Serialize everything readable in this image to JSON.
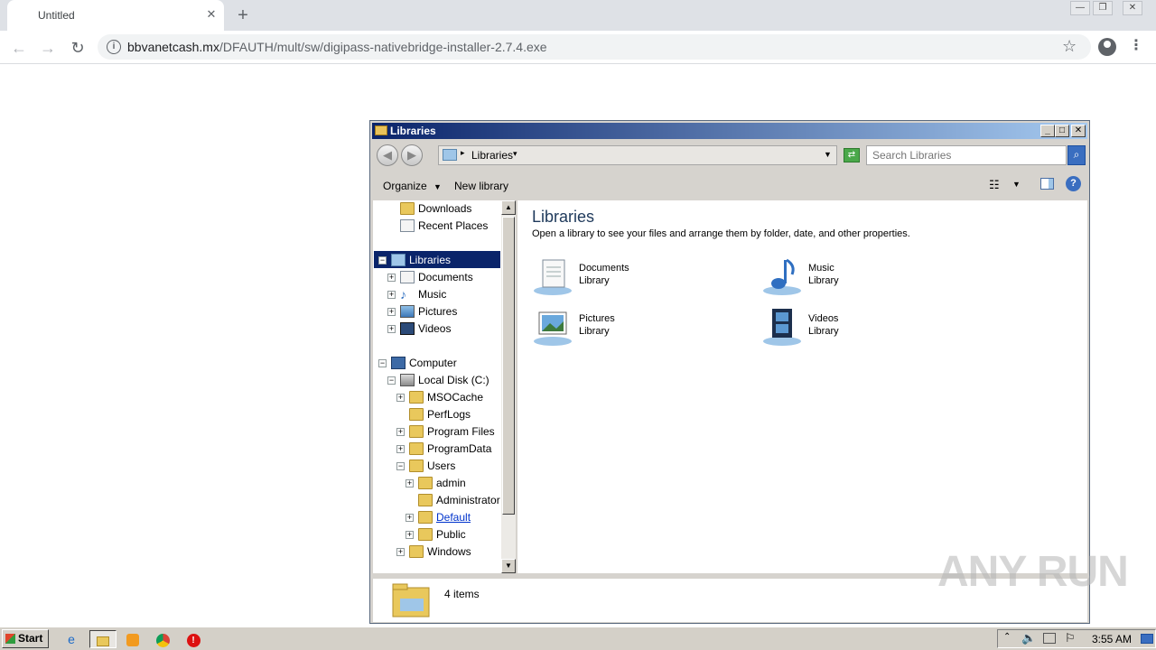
{
  "browser": {
    "tab_title": "Untitled",
    "url_domain": "bbvanetcash.mx",
    "url_path": "/DFAUTH/mult/sw/digipass-nativebridge-installer-2.7.4.exe"
  },
  "explorer": {
    "window_title": "Libraries",
    "breadcrumb": "Libraries",
    "search_placeholder": "Search Libraries",
    "toolbar": {
      "organize": "Organize",
      "new_library": "New library"
    },
    "nav": {
      "downloads": "Downloads",
      "recent_places": "Recent Places",
      "libraries": "Libraries",
      "documents": "Documents",
      "music": "Music",
      "pictures": "Pictures",
      "videos": "Videos",
      "computer": "Computer",
      "local_disk": "Local Disk (C:)",
      "msocache": "MSOCache",
      "perflogs": "PerfLogs",
      "program_files": "Program Files",
      "programdata": "ProgramData",
      "users": "Users",
      "admin": "admin",
      "administrator": "Administrator",
      "default": "Default",
      "public": "Public",
      "windows": "Windows"
    },
    "content": {
      "title": "Libraries",
      "subtitle": "Open a library to see your files and arrange them by folder, date, and other properties.",
      "items": [
        {
          "name": "Documents",
          "type": "Library"
        },
        {
          "name": "Music",
          "type": "Library"
        },
        {
          "name": "Pictures",
          "type": "Library"
        },
        {
          "name": "Videos",
          "type": "Library"
        }
      ]
    },
    "details": {
      "count": "4 items"
    }
  },
  "watermark": "ANY RUN",
  "taskbar": {
    "start": "Start",
    "clock": "3:55 AM"
  }
}
